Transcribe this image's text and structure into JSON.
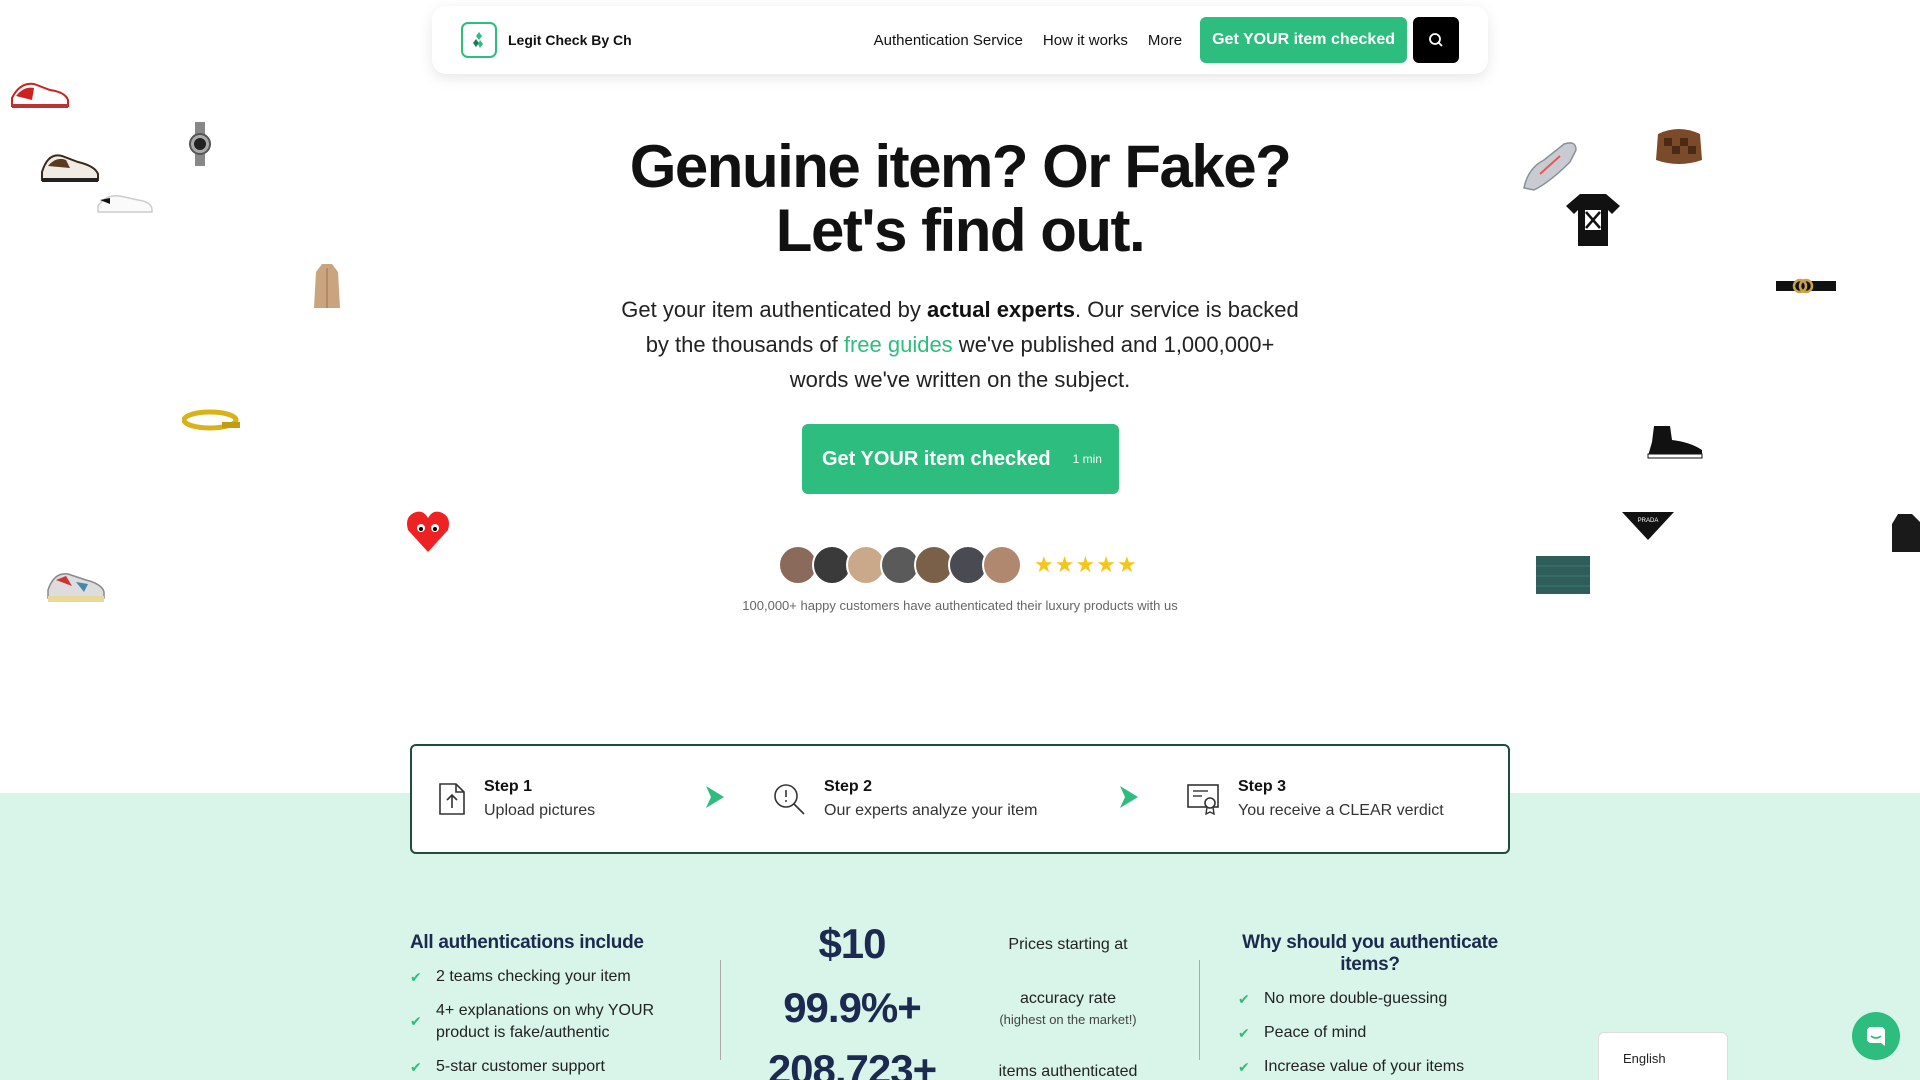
{
  "nav": {
    "brand": "Legit Check By Ch",
    "links": [
      "Authentication Service",
      "How it works",
      "More"
    ],
    "cta": "Get YOUR item checked",
    "search_icon": "search-icon",
    "logo_icon": "logo-diamond-icon"
  },
  "hero": {
    "title_line1": "Genuine item? Or Fake?",
    "title_line2": "Let's find out.",
    "sub_part1": "Get your item authenticated by ",
    "sub_bold": "actual experts",
    "sub_part2": ". Our service is backed by the thousands of ",
    "sub_link": "free guides",
    "sub_part3": " we've published and 1,000,000+ words we've written on the subject.",
    "cta_label": "Get YOUR item checked",
    "cta_time": "1 min",
    "rating_stars": 5,
    "happy_text": "100,000+ happy customers have authenticated their luxury products with us"
  },
  "steps": [
    {
      "title": "Step 1",
      "desc": "Upload pictures",
      "icon": "upload-file-icon"
    },
    {
      "title": "Step 2",
      "desc": "Our experts analyze your item",
      "icon": "magnifier-icon"
    },
    {
      "title": "Step 3",
      "desc": "You receive a CLEAR verdict",
      "icon": "certificate-icon"
    }
  ],
  "includes": {
    "title": "All authentications include",
    "items": [
      "2 teams checking your item",
      "4+ explanations on why YOUR product is fake/authentic",
      "5-star customer support"
    ]
  },
  "stats": [
    {
      "value": "$10",
      "label": "Prices starting at",
      "note": ""
    },
    {
      "value": "99.9%+",
      "label": "accuracy rate",
      "note": "(highest on the market!)"
    },
    {
      "value": "208,723+",
      "label": "items authenticated",
      "note": ""
    }
  ],
  "why": {
    "title": "Why should you authenticate items?",
    "items": [
      "No more double-guessing",
      "Peace of mind",
      "Increase value of your items"
    ]
  },
  "language": "English",
  "colors": {
    "accent": "#2dbd7e",
    "navy": "#1c2a50",
    "band": "#d9f5ea",
    "border": "#1e4d3d",
    "star": "#f5c518"
  }
}
